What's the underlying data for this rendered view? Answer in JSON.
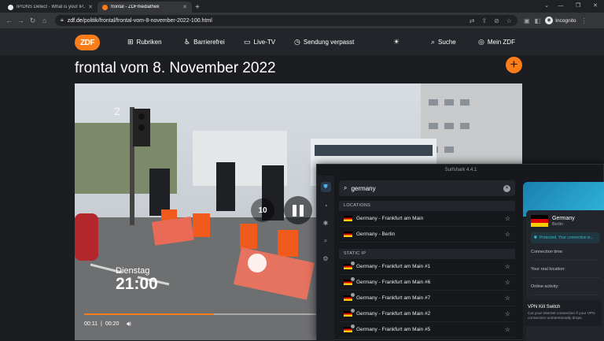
{
  "browser": {
    "tabs": [
      {
        "title": "IP/DNS Detect - What is your IP...",
        "favicon_color": "#e8eaed"
      },
      {
        "title": "frontal - ZDFmediathek",
        "favicon_color": "#fa7d19"
      }
    ],
    "new_tab": "+",
    "url_host": "zdf.de",
    "url_path": "/politik/frontal/frontal-vom-8-november-2022-100.html",
    "profile": "Incognito"
  },
  "zdf": {
    "logo": "ZDF",
    "nav": [
      {
        "label": "Rubriken",
        "icon": "grid-icon"
      },
      {
        "label": "Barrierefrei",
        "icon": "accessibility-icon"
      },
      {
        "label": "Live-TV",
        "icon": "tv-icon"
      },
      {
        "label": "Sendung verpasst",
        "icon": "clock-icon"
      }
    ],
    "search_label": "Suche",
    "account_label": "Mein ZDF",
    "page_title": "frontal vom 8. November 2022",
    "accent": "#fa7d19"
  },
  "player": {
    "weekday": "Dienstag",
    "airtime": "21:00",
    "current_time": "00:11",
    "duration": "00:20",
    "rewind_label": "10",
    "progress": 0.55
  },
  "surfshark": {
    "window_title": "Surfshark 4.4.1",
    "search_value": "germany",
    "locations_header": "LOCATIONS",
    "locations": [
      "Germany - Frankfurt am Main",
      "Germany - Berlin"
    ],
    "static_header": "STATIC IP",
    "static_ips": [
      "Germany - Frankfurt am Main #1",
      "Germany - Frankfurt am Main #6",
      "Germany - Frankfurt am Main #7",
      "Germany - Frankfurt am Main #2",
      "Germany - Frankfurt am Main #5"
    ],
    "connected_country": "Germany",
    "connected_city": "Berlin",
    "protected_text": "Protected. Your connection is...",
    "labels": [
      "Connection time:",
      "Your real location:",
      "Online activity:",
      "Your IP address:"
    ],
    "kill_switch_title": "VPN Kill Switch",
    "kill_switch_desc": "Cut your internet connection if your VPN connection unintentionally drops."
  }
}
